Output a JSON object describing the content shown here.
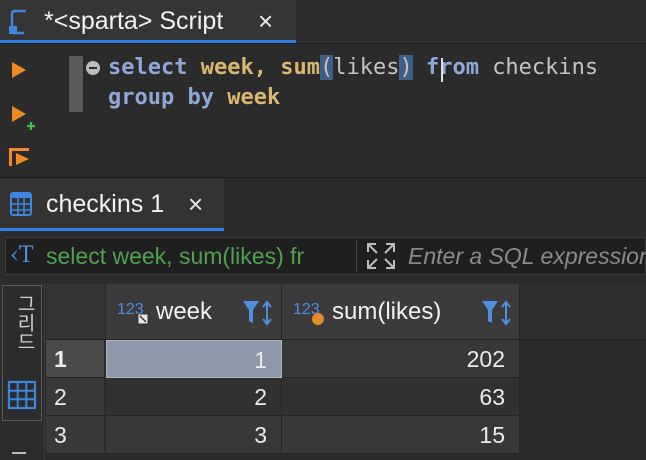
{
  "editor_tab": {
    "title": "*<sparta> Script"
  },
  "sql": {
    "line1": {
      "kw1": "select",
      "col1": "week",
      "comma": ",",
      "fn": "sum",
      "open": "(",
      "arg": "likes",
      "close": ")",
      "kw2": "from",
      "table": "checkins"
    },
    "line2": {
      "kw1": "group by",
      "col": "week"
    }
  },
  "results_tab": {
    "title": "checkins 1"
  },
  "filter": {
    "query": "select week, sum(likes) fr",
    "placeholder": "Enter a SQL expression to filter results"
  },
  "side_panel": {
    "label": "그리드"
  },
  "grid": {
    "columns": [
      {
        "type_badge": "123",
        "label": "week"
      },
      {
        "type_badge": "123",
        "label": "sum(likes)"
      }
    ],
    "rows": [
      {
        "num": "1",
        "week": "1",
        "sum": "202"
      },
      {
        "num": "2",
        "week": "2",
        "sum": "63"
      },
      {
        "num": "3",
        "week": "3",
        "sum": "15"
      }
    ]
  },
  "colors": {
    "accent": "#2f7de1",
    "keyword": "#8fa8d8",
    "column": "#d9b76f",
    "filter_query": "#4fa14f",
    "run_icon": "#f08a24"
  }
}
